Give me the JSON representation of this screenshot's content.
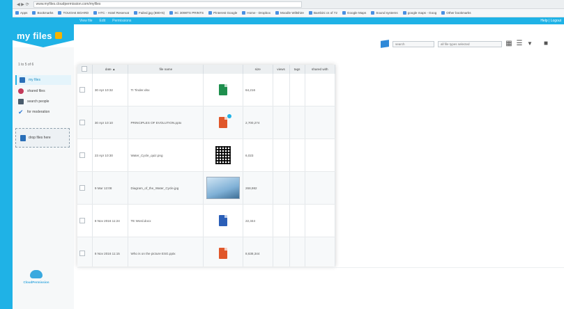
{
  "browser": {
    "address": "www.myfiles.cloudpermission.com/myfiles",
    "bookmarks": [
      "Apps",
      "Bookmarks",
      "TOUGH4 BOARD",
      "HTC - Hotel Reservat",
      "Failed.jpg (880×5)",
      "SC 3098TS PRINTS",
      "Pinterest Google",
      "Home - Dropbox",
      "Moodle Wiltshire",
      "Bambini cs of 72",
      "Google Maps",
      "Sound systems",
      "google maps - Goog",
      "Other bookmarks"
    ]
  },
  "app": {
    "logo": "my files",
    "top_links": [
      "View file",
      "Edit",
      "Permissions"
    ],
    "user": "Help | Logout"
  },
  "sidebar": {
    "count": "1 to 5 of 6",
    "items": [
      {
        "label": "my files",
        "icon": "folder-icon",
        "color": "#2a6fb8"
      },
      {
        "label": "shared files",
        "icon": "share-icon",
        "color": "#c43a5a"
      },
      {
        "label": "search people",
        "icon": "people-icon",
        "color": "#4b5c6c"
      },
      {
        "label": "for moderation",
        "icon": "check-icon",
        "color": "#2f7bd6"
      }
    ],
    "drop_label": "drop files here",
    "brand": "CloudPermission"
  },
  "toolbar": {
    "search_placeholder": "search",
    "types_placeholder": "all file types selected"
  },
  "table": {
    "headers": [
      "",
      "date",
      "file name",
      "",
      "size",
      "views",
      "tags",
      "shared with"
    ],
    "rows": [
      {
        "date": "30 Apr 10:32",
        "name": "TI Tinder.xlsx",
        "thumb": "xlsx",
        "size": "64,216"
      },
      {
        "date": "30 Apr 10:10",
        "name": "PRINCIPLES OF EVOLUTION.pptx",
        "thumb": "pptx",
        "size": "2,700,274"
      },
      {
        "date": "23 Apr 10:30",
        "name": "Water_Cycle_quiz.png",
        "thumb": "qr",
        "size": "6,023"
      },
      {
        "date": "9 Mar 12:08",
        "name": "Diagram_of_the_Water_Cycle.jpg",
        "thumb": "img",
        "size": "268,982"
      },
      {
        "date": "8 Nov 2016 11:24",
        "name": "TE Word.docx",
        "thumb": "docx",
        "size": "22,344"
      },
      {
        "date": "8 Nov 2016 11:15",
        "name": "Who is on the picture ESG.pptx",
        "thumb": "pptx",
        "size": "8,638,344"
      }
    ]
  }
}
